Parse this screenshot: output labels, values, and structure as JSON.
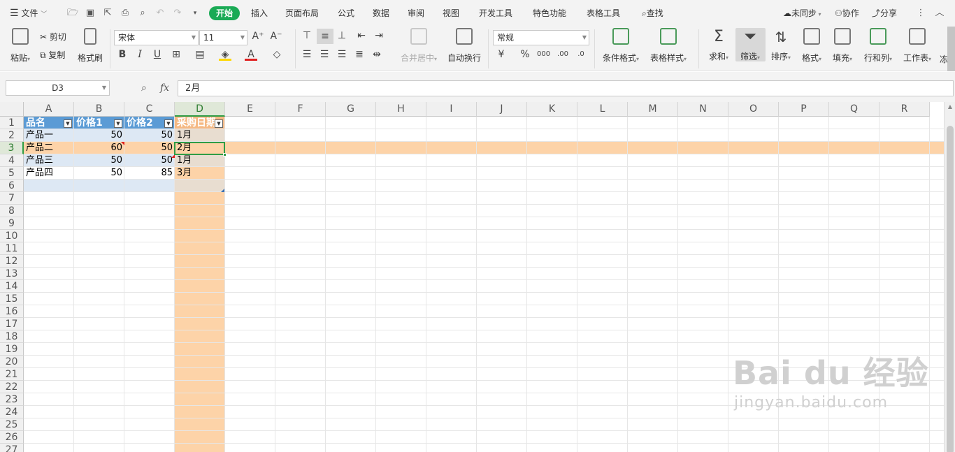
{
  "menubar": {
    "file": "文件",
    "tabs": [
      "开始",
      "插入",
      "页面布局",
      "公式",
      "数据",
      "审阅",
      "视图",
      "开发工具",
      "特色功能",
      "表格工具"
    ],
    "search": "查找",
    "sync": "未同步",
    "collab": "协作",
    "share": "分享"
  },
  "ribbon": {
    "paste": "粘贴",
    "cut": "剪切",
    "copy": "复制",
    "format_painter": "格式刷",
    "font_name": "宋体",
    "font_size": "11",
    "merge_center": "合并居中",
    "wrap_text": "自动换行",
    "number_format": "常规",
    "conditional_format": "条件格式",
    "table_style": "表格样式",
    "sum": "求和",
    "filter": "筛选",
    "sort": "排序",
    "format": "格式",
    "fill": "填充",
    "row_col": "行和列",
    "worksheet": "工作表",
    "freeze": "冻"
  },
  "formula_bar": {
    "name_box": "D3",
    "fx": "fx",
    "value": "2月"
  },
  "sheet": {
    "columns": [
      "A",
      "B",
      "C",
      "D",
      "E",
      "F",
      "G",
      "H",
      "I",
      "J",
      "K",
      "L",
      "M",
      "N",
      "O",
      "P",
      "Q",
      "R"
    ],
    "rows": [
      "1",
      "2",
      "3",
      "4",
      "5",
      "6",
      "7",
      "8",
      "9",
      "10",
      "11",
      "12",
      "13",
      "14",
      "15",
      "16",
      "17",
      "18",
      "19",
      "20",
      "21",
      "22",
      "23",
      "24",
      "25",
      "26",
      "27"
    ],
    "header": [
      "品名",
      "价格1",
      "价格2",
      "采购日期"
    ],
    "data": [
      [
        "产品一",
        "50",
        "50",
        "1月"
      ],
      [
        "产品二",
        "60",
        "50",
        "2月"
      ],
      [
        "产品三",
        "50",
        "50",
        "1月"
      ],
      [
        "产品四",
        "50",
        "85",
        "3月"
      ]
    ]
  },
  "watermark": {
    "logo": "Bai du 经验",
    "url": "jingyan.baidu.com"
  },
  "colors": {
    "accent_green": "#1aaa55",
    "table_header_blue": "#5b9bd5",
    "table_band_light": "#dde8f4",
    "highlight_peach": "#fdd3a8",
    "selection_green": "#2f9d46"
  }
}
